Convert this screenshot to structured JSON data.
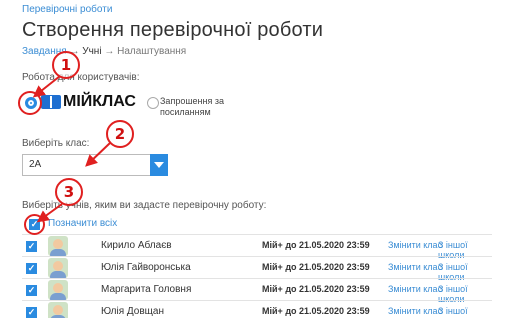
{
  "breadcrumb": "Перевірочні роботи",
  "page_title": "Створення перевірочної роботи",
  "steps": {
    "step1": "Завдання",
    "sep1": " → ",
    "step2": "Учні",
    "sep2": " → ",
    "step3": "Налаштування"
  },
  "users_label": "Робота для користувачів:",
  "option_miyklas": "МІЙКЛАС",
  "option_invite": "Запрошення за посиланням",
  "class_label": "Виберіть клас:",
  "class_value": "2А",
  "students_label": "Виберіть учнів, яким ви задасте перевірочну роботу:",
  "mark_all": "Позначити всіх",
  "students": [
    {
      "name": "Кирило Аблаєв",
      "access_prefix": "Мій+",
      "access_suffix": "до 21.05.2020 23:59",
      "change": "Змінити клас",
      "other": "З іншої школи"
    },
    {
      "name": "Юлія Гайворонська",
      "access_prefix": "Мій+",
      "access_suffix": "до 21.05.2020 23:59",
      "change": "Змінити клас",
      "other": "З іншої школи"
    },
    {
      "name": "Маргарита Головня",
      "access_prefix": "Мій+",
      "access_suffix": "до 21.05.2020 23:59",
      "change": "Змінити клас",
      "other": "З іншої школи"
    },
    {
      "name": "Юлія Довщан",
      "access_prefix": "Мій+",
      "access_suffix": "до 21.05.2020 23:59",
      "change": "Змінити клас",
      "other": "З іншої школи"
    }
  ],
  "annotations": [
    "1",
    "2",
    "3"
  ],
  "colors": {
    "accent": "#2a8be0",
    "annotation": "#e02020",
    "link": "#3b8dd4"
  },
  "icons": {
    "logo": "book-icon",
    "dropdown": "chevron-down-icon",
    "check": "check-icon"
  }
}
